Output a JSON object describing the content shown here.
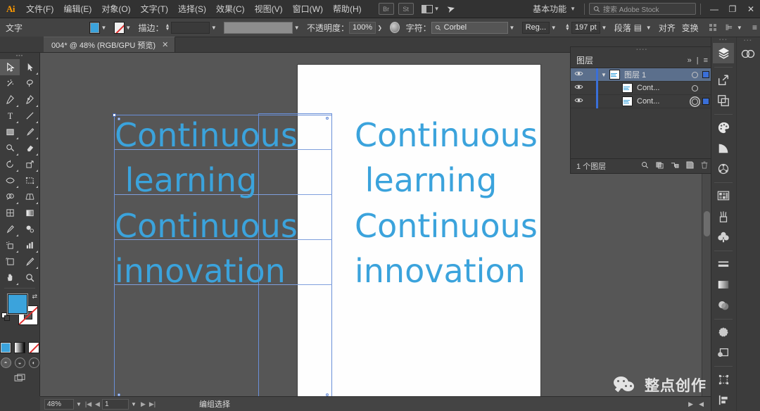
{
  "app": {
    "logo": "Ai",
    "menus": [
      "文件(F)",
      "编辑(E)",
      "对象(O)",
      "文字(T)",
      "选择(S)",
      "效果(C)",
      "视图(V)",
      "窗口(W)",
      "帮助(H)"
    ],
    "quick_icons": [
      "Br",
      "St"
    ],
    "workspace": "基本功能",
    "search_placeholder": "搜索 Adobe Stock",
    "window_buttons": {
      "minimize": "—",
      "restore": "❐",
      "close": "✕"
    }
  },
  "control_bar": {
    "tool_label": "文字",
    "fill_color": "#3ba3dc",
    "stroke_label": "描边：",
    "stroke_weight": "",
    "stroke_profile": "",
    "opacity_label": "不透明度：",
    "opacity_value": "100%",
    "character_label": "字符：",
    "font_family": "Corbel",
    "font_style": "Reg...",
    "font_size": "197 pt",
    "paragraph_label": "段落",
    "align_label": "对齐",
    "transform_label": "变换"
  },
  "document_tab": {
    "title": "004* @ 48% (RGB/GPU 预览)",
    "close": "✕"
  },
  "toolbar": {
    "tools": [
      {
        "name": "selection-tool",
        "active": true
      },
      {
        "name": "direct-selection-tool",
        "active": false
      },
      {
        "name": "magic-wand-tool",
        "active": false
      },
      {
        "name": "lasso-tool",
        "active": false
      },
      {
        "name": "pen-tool",
        "active": false
      },
      {
        "name": "curvature-tool",
        "active": false
      },
      {
        "name": "type-tool",
        "active": false
      },
      {
        "name": "line-segment-tool",
        "active": false
      },
      {
        "name": "rectangle-tool",
        "active": false
      },
      {
        "name": "paintbrush-tool",
        "active": false
      },
      {
        "name": "shaper-tool",
        "active": false
      },
      {
        "name": "eraser-tool",
        "active": false
      },
      {
        "name": "rotate-tool",
        "active": false
      },
      {
        "name": "scale-tool",
        "active": false
      },
      {
        "name": "width-tool",
        "active": false
      },
      {
        "name": "free-transform-tool",
        "active": false
      },
      {
        "name": "shape-builder-tool",
        "active": false
      },
      {
        "name": "perspective-grid-tool",
        "active": false
      },
      {
        "name": "mesh-tool",
        "active": false
      },
      {
        "name": "gradient-tool",
        "active": false
      },
      {
        "name": "eyedropper-tool",
        "active": false
      },
      {
        "name": "blend-tool",
        "active": false
      },
      {
        "name": "symbol-sprayer-tool",
        "active": false
      },
      {
        "name": "column-graph-tool",
        "active": false
      },
      {
        "name": "artboard-tool",
        "active": false
      },
      {
        "name": "slice-tool",
        "active": false
      },
      {
        "name": "hand-tool",
        "active": false
      },
      {
        "name": "zoom-tool",
        "active": false
      }
    ],
    "fill": "#3ba3dc",
    "stroke": "none"
  },
  "canvas": {
    "artboard_text_lines": [
      "Continuous",
      " learning",
      "Continuous",
      "innovation"
    ],
    "selected_text_lines": [
      "Continuous",
      " learning",
      "Continuous",
      "innovation"
    ],
    "text_color": "#3ba3dc",
    "selection_color": "#6a8fd8"
  },
  "layers_panel": {
    "title": "图层",
    "menu_icons": [
      "»",
      "≡"
    ],
    "rows": [
      {
        "name": "图层 1",
        "selected": true,
        "visible": true,
        "expanded": true
      },
      {
        "name": "Cont...",
        "selected": false,
        "visible": true,
        "expanded": false
      },
      {
        "name": "Cont...",
        "selected": false,
        "visible": true,
        "expanded": false
      }
    ],
    "footer_count": "1 个图层",
    "footer_icons": [
      "locate-object",
      "make-clipping-mask",
      "create-sublayer",
      "create-new-layer",
      "delete-layer"
    ]
  },
  "right_rail": {
    "panels": [
      {
        "name": "layers-panel-icon",
        "active": true
      },
      {
        "name": "cc-libraries-icon",
        "active": false
      },
      {
        "name": "asset-export-icon",
        "active": false
      },
      {
        "name": "artboards-icon",
        "active": false
      },
      {
        "name": "color-panel-icon",
        "active": false
      },
      {
        "name": "color-guide-icon",
        "active": false
      },
      {
        "name": "color-themes-icon",
        "active": false
      },
      {
        "name": "swatches-icon",
        "active": false
      },
      {
        "name": "brushes-icon",
        "active": false
      },
      {
        "name": "symbols-icon",
        "active": false
      },
      {
        "name": "stroke-panel-icon",
        "active": false
      },
      {
        "name": "gradient-panel-icon",
        "active": false
      },
      {
        "name": "transparency-icon",
        "active": false
      },
      {
        "name": "appearance-icon",
        "active": false
      },
      {
        "name": "graphic-styles-icon",
        "active": false
      },
      {
        "name": "transform-icon",
        "active": false
      },
      {
        "name": "align-icon",
        "active": false
      }
    ]
  },
  "status_bar": {
    "zoom": "48%",
    "page": "1",
    "status_text": "编组选择"
  },
  "watermark": {
    "text": "整点创作"
  }
}
